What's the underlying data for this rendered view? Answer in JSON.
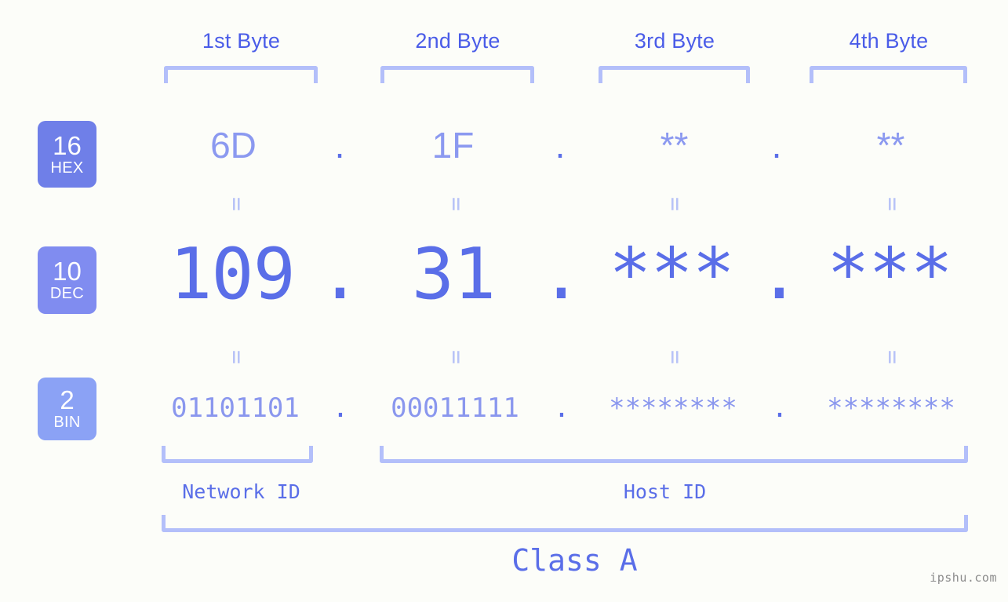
{
  "background_color": "#fcfdf9",
  "accent_color": "#5a6ee8",
  "bracket_color": "#b3bffa",
  "byte_headers": [
    {
      "label": "1st Byte"
    },
    {
      "label": "2nd Byte"
    },
    {
      "label": "3rd Byte"
    },
    {
      "label": "4th Byte"
    }
  ],
  "bases": [
    {
      "num": "16",
      "abbr": "HEX",
      "color": "#6f7fe8"
    },
    {
      "num": "10",
      "abbr": "DEC",
      "color": "#808cf0"
    },
    {
      "num": "2",
      "abbr": "BIN",
      "color": "#8ba2f5"
    }
  ],
  "separator": ".",
  "rows": {
    "hex": {
      "values": [
        "6D",
        "1F",
        "**",
        "**"
      ]
    },
    "dec": {
      "values": [
        "109",
        "31",
        "***",
        "***"
      ]
    },
    "bin": {
      "values": [
        "01101101",
        "00011111",
        "********",
        "********"
      ]
    }
  },
  "equals_symbol": "=",
  "sections": {
    "network_id": "Network ID",
    "host_id": "Host ID",
    "class": "Class A"
  },
  "watermark": "ipshu.com"
}
